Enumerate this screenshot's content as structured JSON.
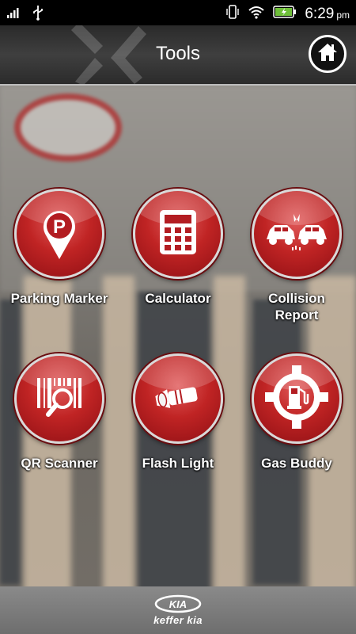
{
  "status_bar": {
    "time": "6:29",
    "ampm": "pm"
  },
  "header": {
    "title": "Tools"
  },
  "tools": [
    {
      "label": "Parking Marker",
      "icon": "parking-pin-icon"
    },
    {
      "label": "Calculator",
      "icon": "calculator-icon"
    },
    {
      "label": "Collision Report",
      "icon": "car-collision-icon"
    },
    {
      "label": "QR Scanner",
      "icon": "qr-scanner-icon"
    },
    {
      "label": "Flash Light",
      "icon": "flashlight-icon"
    },
    {
      "label": "Gas Buddy",
      "icon": "gas-pump-icon"
    }
  ],
  "footer": {
    "logo_text": "KIA",
    "dealer_name": "keffer kia"
  },
  "colors": {
    "accent_red": "#c02424",
    "header_dark": "#333333"
  }
}
